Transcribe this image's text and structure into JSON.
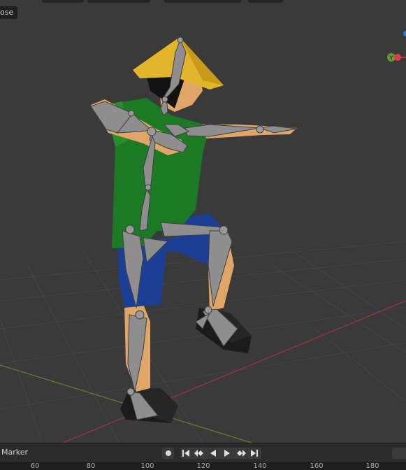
{
  "viewport": {
    "mode_label": "ose",
    "gizmo": {
      "axis_y_label": "Y"
    }
  },
  "timeline": {
    "marker_label": "Marker",
    "frame_ticks": [
      "60",
      "80",
      "100",
      "120",
      "140",
      "160",
      "180"
    ]
  },
  "colors": {
    "viewport_bg": "#3a3a3a",
    "grid_x_axis": "#9b3341",
    "grid_y_axis": "#5a7f2a",
    "bone": "#8e8e8e",
    "shirt": "#1d7a24",
    "shorts": "#1c3f96",
    "hat": "#e2b42a",
    "skin": "#e0a667"
  }
}
